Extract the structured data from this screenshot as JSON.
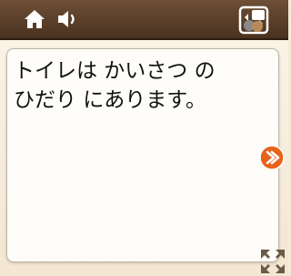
{
  "toolbar": {
    "home_icon": "home-icon",
    "speaker_icon": "speaker-icon",
    "swap_icon": "swap-card-icon"
  },
  "card": {
    "text": "トイレは かいさつ の\nひだり にあります。"
  },
  "controls": {
    "next_icon": "chevron-right-icon",
    "expand_icon": "expand-icon"
  },
  "colors": {
    "toolbar": "#5b3f2a",
    "accent_orange": "#e8621a",
    "background": "#f5ead8",
    "card": "#fffdf9"
  }
}
